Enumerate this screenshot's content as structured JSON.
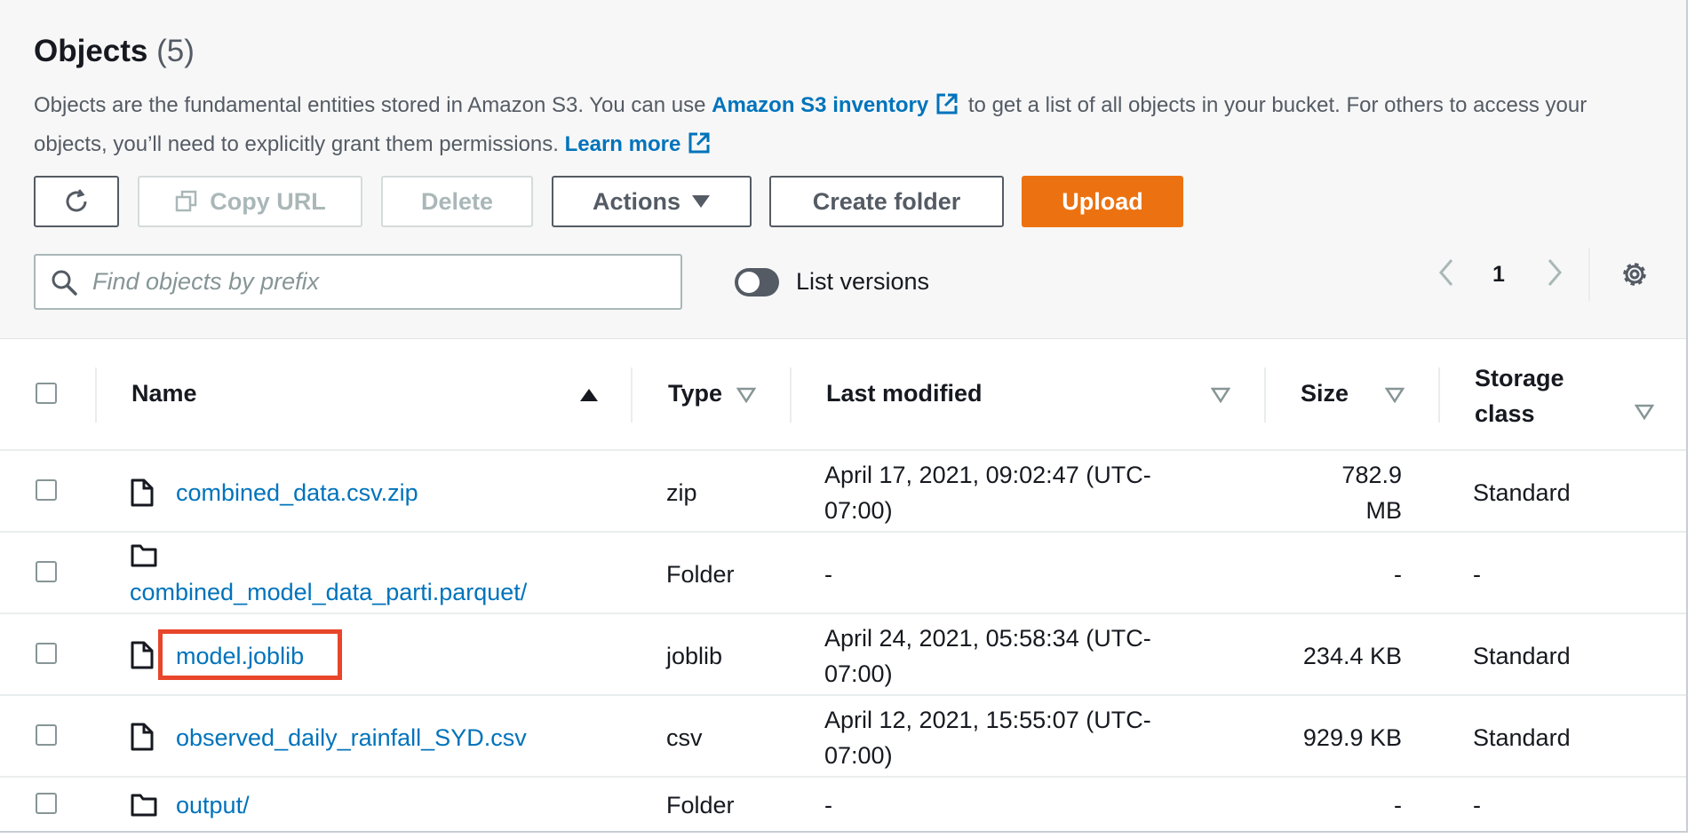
{
  "header": {
    "title": "Objects",
    "count": "(5)",
    "description": {
      "part1": "Objects are the fundamental entities stored in Amazon S3. You can use ",
      "inventory_link": "Amazon S3 inventory",
      "part2": " to get a list of all objects in your bucket. For others to access your objects, you’ll need to explicitly grant them permissions. ",
      "learn_more": "Learn more"
    }
  },
  "toolbar": {
    "copy_url": "Copy URL",
    "delete": "Delete",
    "actions": "Actions",
    "create_folder": "Create folder",
    "upload": "Upload"
  },
  "search": {
    "placeholder": "Find objects by prefix",
    "value": ""
  },
  "versions_toggle": {
    "label": "List versions",
    "on": false
  },
  "pagination": {
    "current_page": "1"
  },
  "table": {
    "columns": {
      "name": "Name",
      "type": "Type",
      "last_modified": "Last modified",
      "size": "Size",
      "storage_class_line1": "Storage",
      "storage_class_line2": "class"
    },
    "sort": {
      "column": "Name",
      "direction": "ascending"
    },
    "rows": [
      {
        "icon": "file-icon",
        "name": "combined_data.csv.zip",
        "type": "zip",
        "modified_1": "April 17, 2021, 09:02:47 (UTC-",
        "modified_2": "07:00)",
        "size_1": "782.9",
        "size_2": "MB",
        "storage": "Standard"
      },
      {
        "icon": "folder-icon",
        "name": "combined_model_data_parti.parquet/",
        "type": "Folder",
        "modified_1": "-",
        "modified_2": "",
        "size_1": "-",
        "size_2": "",
        "storage": "-"
      },
      {
        "icon": "file-icon",
        "name": "model.joblib",
        "type": "joblib",
        "modified_1": "April 24, 2021, 05:58:34 (UTC-",
        "modified_2": "07:00)",
        "size_1": "234.4 KB",
        "size_2": "",
        "storage": "Standard",
        "highlighted": true
      },
      {
        "icon": "file-icon",
        "name": "observed_daily_rainfall_SYD.csv",
        "type": "csv",
        "modified_1": "April 12, 2021, 15:55:07 (UTC-",
        "modified_2": "07:00)",
        "size_1": "929.9 KB",
        "size_2": "",
        "storage": "Standard"
      },
      {
        "icon": "folder-icon",
        "name": "output/",
        "type": "Folder",
        "modified_1": "-",
        "modified_2": "",
        "size_1": "-",
        "size_2": "",
        "storage": "-"
      }
    ]
  },
  "colors": {
    "link": "#0073bb",
    "primary_button": "#ec7211",
    "highlight_box": "#e8452a",
    "toggle_off": "#545b64"
  }
}
